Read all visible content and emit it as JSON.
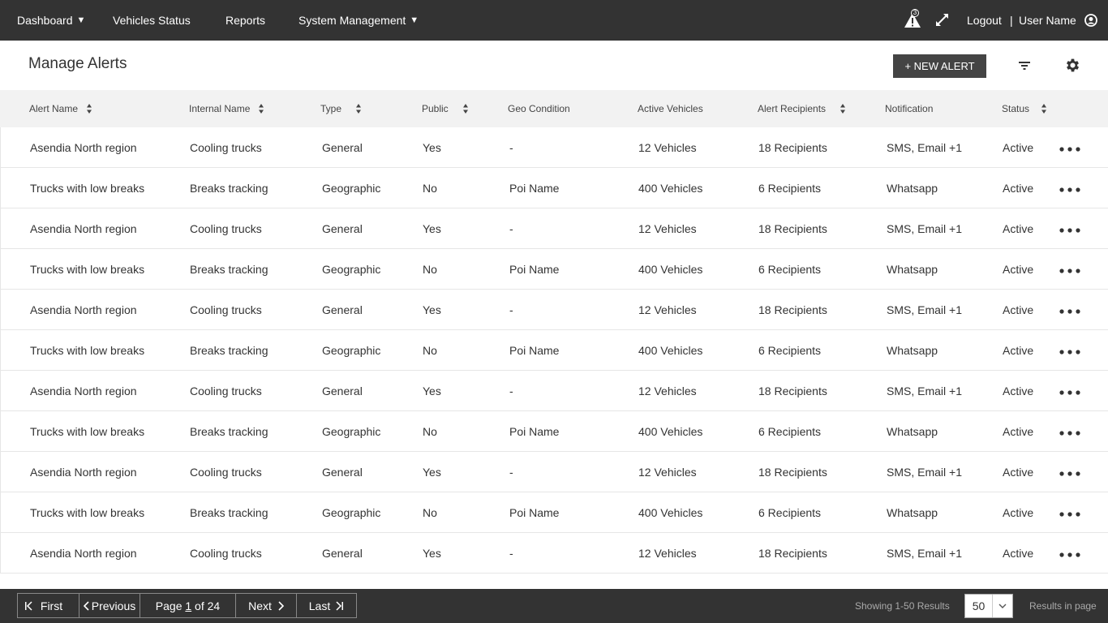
{
  "nav": {
    "items": [
      {
        "label": "Dashboard",
        "caret": "▼"
      },
      {
        "label": "Vehicles Status"
      },
      {
        "label": "Reports"
      },
      {
        "label": "System Management",
        "caret": "▼"
      }
    ],
    "alert_badge": "3",
    "logout": "Logout",
    "divider": "|",
    "username": "User Name"
  },
  "header": {
    "title": "Manage Alerts",
    "new_alert": "+ NEW ALERT"
  },
  "table": {
    "columns": [
      {
        "label": "Alert Name",
        "sortable": true
      },
      {
        "label": "Internal Name",
        "sortable": true
      },
      {
        "label": "Type",
        "sortable": true
      },
      {
        "label": "Public",
        "sortable": true
      },
      {
        "label": "Geo Condition",
        "sortable": false
      },
      {
        "label": "Active Vehicles",
        "sortable": false
      },
      {
        "label": "Alert Recipients",
        "sortable": true
      },
      {
        "label": "Notification",
        "sortable": false
      },
      {
        "label": "Status",
        "sortable": true
      }
    ],
    "rows": [
      [
        "Asendia North region",
        "Cooling trucks",
        "General",
        "Yes",
        "-",
        "12 Vehicles",
        "18 Recipients",
        "SMS, Email +1",
        "Active"
      ],
      [
        "Trucks with low breaks",
        "Breaks tracking",
        "Geographic",
        "No",
        "Poi Name",
        "400 Vehicles",
        "6 Recipients",
        "Whatsapp",
        "Active"
      ],
      [
        "Asendia North region",
        "Cooling trucks",
        "General",
        "Yes",
        "-",
        "12 Vehicles",
        "18 Recipients",
        "SMS, Email +1",
        "Active"
      ],
      [
        "Trucks with low breaks",
        "Breaks tracking",
        "Geographic",
        "No",
        "Poi Name",
        "400 Vehicles",
        "6 Recipients",
        "Whatsapp",
        "Active"
      ],
      [
        "Asendia North region",
        "Cooling trucks",
        "General",
        "Yes",
        "-",
        "12 Vehicles",
        "18 Recipients",
        "SMS, Email +1",
        "Active"
      ],
      [
        "Trucks with low breaks",
        "Breaks tracking",
        "Geographic",
        "No",
        "Poi Name",
        "400 Vehicles",
        "6 Recipients",
        "Whatsapp",
        "Active"
      ],
      [
        "Asendia North region",
        "Cooling trucks",
        "General",
        "Yes",
        "-",
        "12 Vehicles",
        "18 Recipients",
        "SMS, Email +1",
        "Active"
      ],
      [
        "Trucks with low breaks",
        "Breaks tracking",
        "Geographic",
        "No",
        "Poi Name",
        "400 Vehicles",
        "6 Recipients",
        "Whatsapp",
        "Active"
      ],
      [
        "Asendia North region",
        "Cooling trucks",
        "General",
        "Yes",
        "-",
        "12 Vehicles",
        "18 Recipients",
        "SMS, Email +1",
        "Active"
      ],
      [
        "Trucks with low breaks",
        "Breaks tracking",
        "Geographic",
        "No",
        "Poi Name",
        "400 Vehicles",
        "6 Recipients",
        "Whatsapp",
        "Active"
      ],
      [
        "Asendia North region",
        "Cooling trucks",
        "General",
        "Yes",
        "-",
        "12 Vehicles",
        "18 Recipients",
        "SMS, Email +1",
        "Active"
      ]
    ]
  },
  "pagination": {
    "first": "First",
    "previous": "Previous",
    "page_prefix": "Page ",
    "page_current": "1",
    "page_suffix": " of 24",
    "next": "Next",
    "last": "Last",
    "showing": "Showing 1-50 Results",
    "per_page": "50",
    "results_label": "Results in page"
  },
  "icons": {
    "alert": "warning-triangle-icon",
    "expand": "expand-arrows-icon",
    "user": "user-circle-icon",
    "filter": "filter-icon",
    "settings": "gear-icon",
    "row_menu": "more-horizontal-icon"
  },
  "colors": {
    "topbar": "#333333",
    "header_row": "#f2f2f2",
    "primary_button": "#444444"
  }
}
